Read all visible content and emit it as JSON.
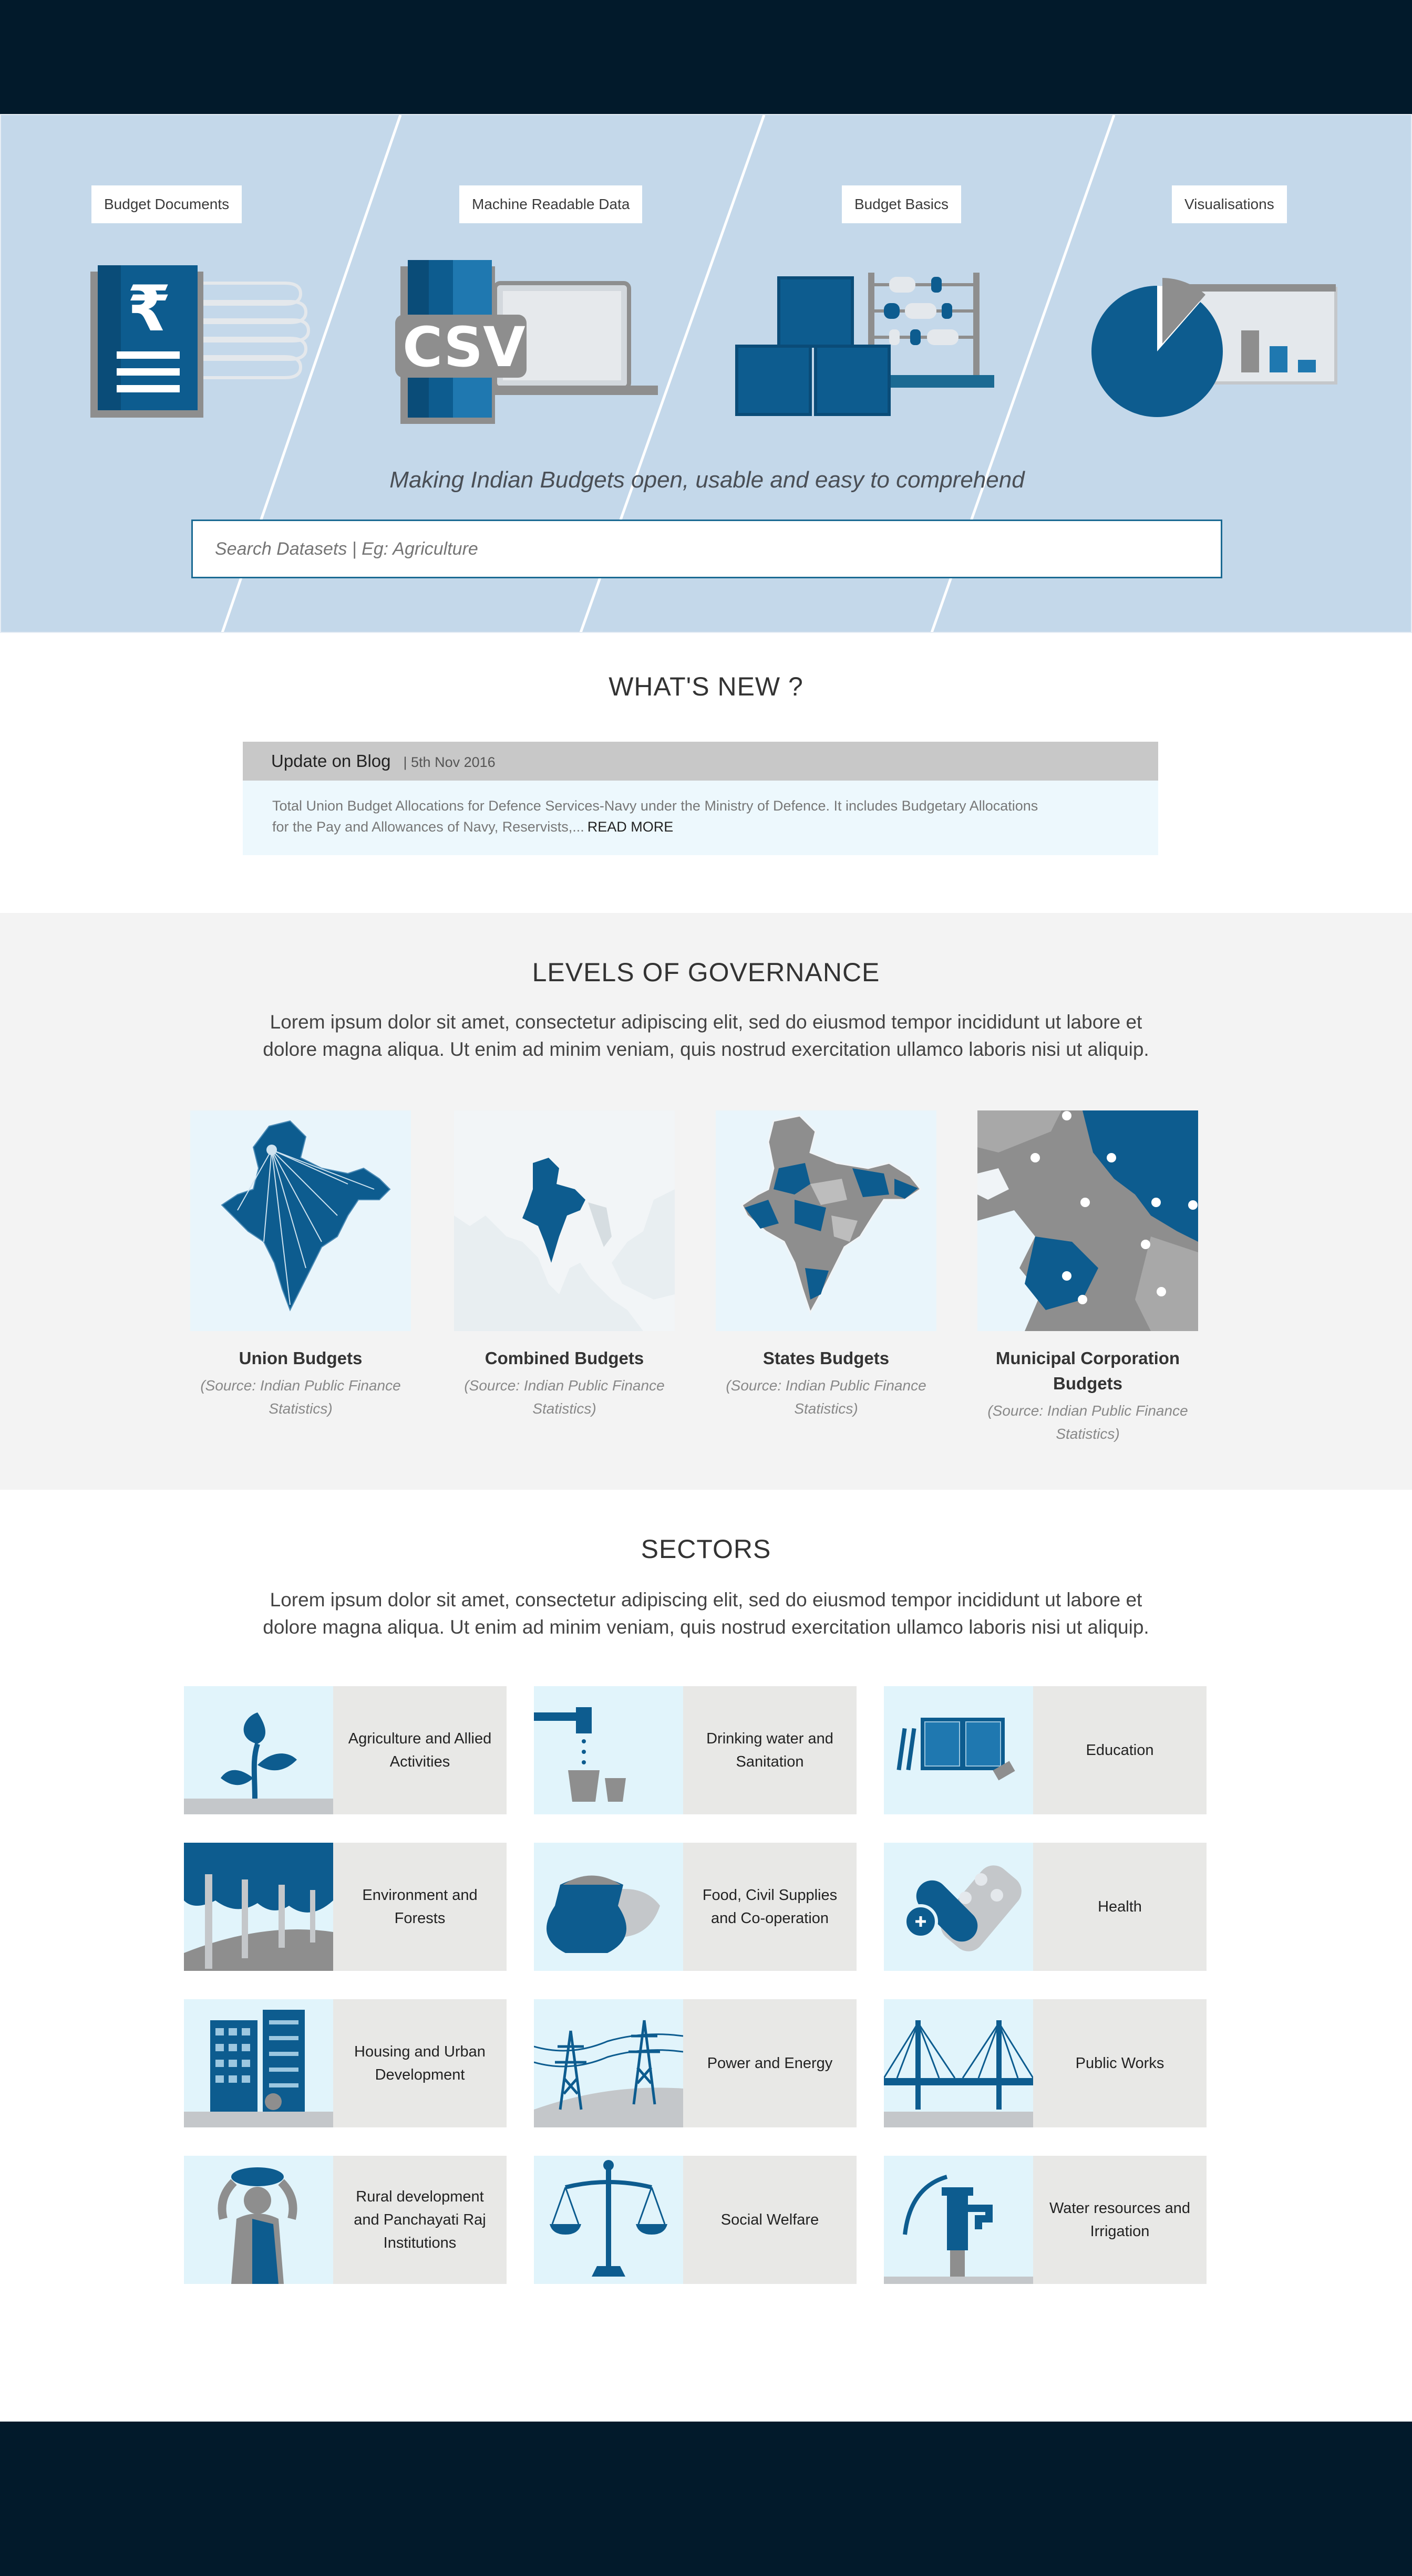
{
  "colors": {
    "header_bg": "#021a2b",
    "hero_bg": "#c4d8ea",
    "accent_blue": "#0d5c8f",
    "grey": "#8e8e8e"
  },
  "hero": {
    "tags": [
      "Budget Documents",
      "Machine Readable Data",
      "Budget Basics",
      "Visualisations"
    ],
    "tagline": "Making Indian Budgets open, usable and easy to comprehend",
    "search_placeholder": "Search Datasets | Eg: Agriculture",
    "csv_text": "CSV",
    "rupee_symbol": "₹"
  },
  "whats_new": {
    "title": "WHAT'S NEW ?",
    "item_title": "Update on Blog",
    "item_date": "| 5th Nov 2016",
    "item_text_line1": "Total Union Budget Allocations for Defence Services-Navy under the Ministry of Defence. It includes Budgetary Allocations",
    "item_text_line2": "for the Pay and Allowances of Navy, Reservists,...",
    "read_more": "READ MORE"
  },
  "levels": {
    "title": "LEVELS OF GOVERNANCE",
    "lorem_line1": "Lorem ipsum dolor sit amet, consectetur adipiscing elit, sed do eiusmod tempor incididunt ut labore et",
    "lorem_line2": "dolore magna aliqua. Ut enim ad minim veniam, quis nostrud exercitation ullamco laboris nisi ut aliquip.",
    "cards": [
      {
        "name": "Union Budgets",
        "source": "(Source: Indian Public Finance Statistics)"
      },
      {
        "name": "Combined Budgets",
        "source": "(Source: Indian Public Finance Statistics)"
      },
      {
        "name": "States Budgets",
        "source": "(Source: Indian Public Finance Statistics)"
      },
      {
        "name": "Municipal Corporation Budgets",
        "source": "(Source: Indian Public Finance Statistics)"
      }
    ]
  },
  "sectors": {
    "title": "SECTORS",
    "lorem_line1": "Lorem ipsum dolor sit amet, consectetur adipiscing elit, sed do eiusmod tempor incididunt ut labore et",
    "lorem_line2": "dolore magna aliqua. Ut enim ad minim veniam, quis nostrud exercitation ullamco laboris nisi ut aliquip.",
    "items": [
      {
        "label": "Agriculture and Allied Activities",
        "icon": "plant-icon"
      },
      {
        "label": "Drinking water and Sanitation",
        "icon": "water-tap-icon"
      },
      {
        "label": "Education",
        "icon": "book-icon"
      },
      {
        "label": "Environment and Forests",
        "icon": "forest-icon"
      },
      {
        "label": "Food, Civil Supplies and Co-operation",
        "icon": "grain-sack-icon"
      },
      {
        "label": "Health",
        "icon": "medicine-icon"
      },
      {
        "label": "Housing and Urban Development",
        "icon": "building-icon"
      },
      {
        "label": "Power and Energy",
        "icon": "power-tower-icon"
      },
      {
        "label": "Public Works",
        "icon": "bridge-icon"
      },
      {
        "label": "Rural development and Panchayati Raj Institutions",
        "icon": "rural-woman-icon"
      },
      {
        "label": "Social Welfare",
        "icon": "scales-icon"
      },
      {
        "label": "Water resources and Irrigation",
        "icon": "hand-pump-icon"
      }
    ]
  }
}
